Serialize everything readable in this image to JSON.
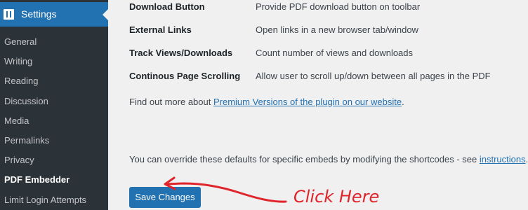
{
  "sidebar": {
    "header": {
      "label": "Settings",
      "icon": "settings-icon"
    },
    "items": [
      {
        "label": "General"
      },
      {
        "label": "Writing"
      },
      {
        "label": "Reading"
      },
      {
        "label": "Discussion"
      },
      {
        "label": "Media"
      },
      {
        "label": "Permalinks"
      },
      {
        "label": "Privacy"
      },
      {
        "label": "PDF Embedder",
        "current": true
      },
      {
        "label": "Limit Login Attempts"
      }
    ]
  },
  "main": {
    "options": [
      {
        "label": "Download Button",
        "desc": "Provide PDF download button on toolbar"
      },
      {
        "label": "External Links",
        "desc": "Open links in a new browser tab/window"
      },
      {
        "label": "Track Views/Downloads",
        "desc": "Count number of views and downloads"
      },
      {
        "label": "Continous Page Scrolling",
        "desc": "Allow user to scroll up/down between all pages in the PDF"
      }
    ],
    "find_more": {
      "prefix": "Find out more about ",
      "link": "Premium Versions of the plugin on our website",
      "suffix": "."
    },
    "override": {
      "prefix": "You can override these defaults for specific embeds by modifying the shortcodes - see ",
      "link": "instructions",
      "suffix": "."
    },
    "save_label": "Save Changes"
  },
  "annotation": {
    "text": "Click Here",
    "color": "#e0242b"
  },
  "colors": {
    "sidebar_bg": "#2c3338",
    "accent": "#2271b1",
    "page_bg": "#f0f0f1"
  }
}
